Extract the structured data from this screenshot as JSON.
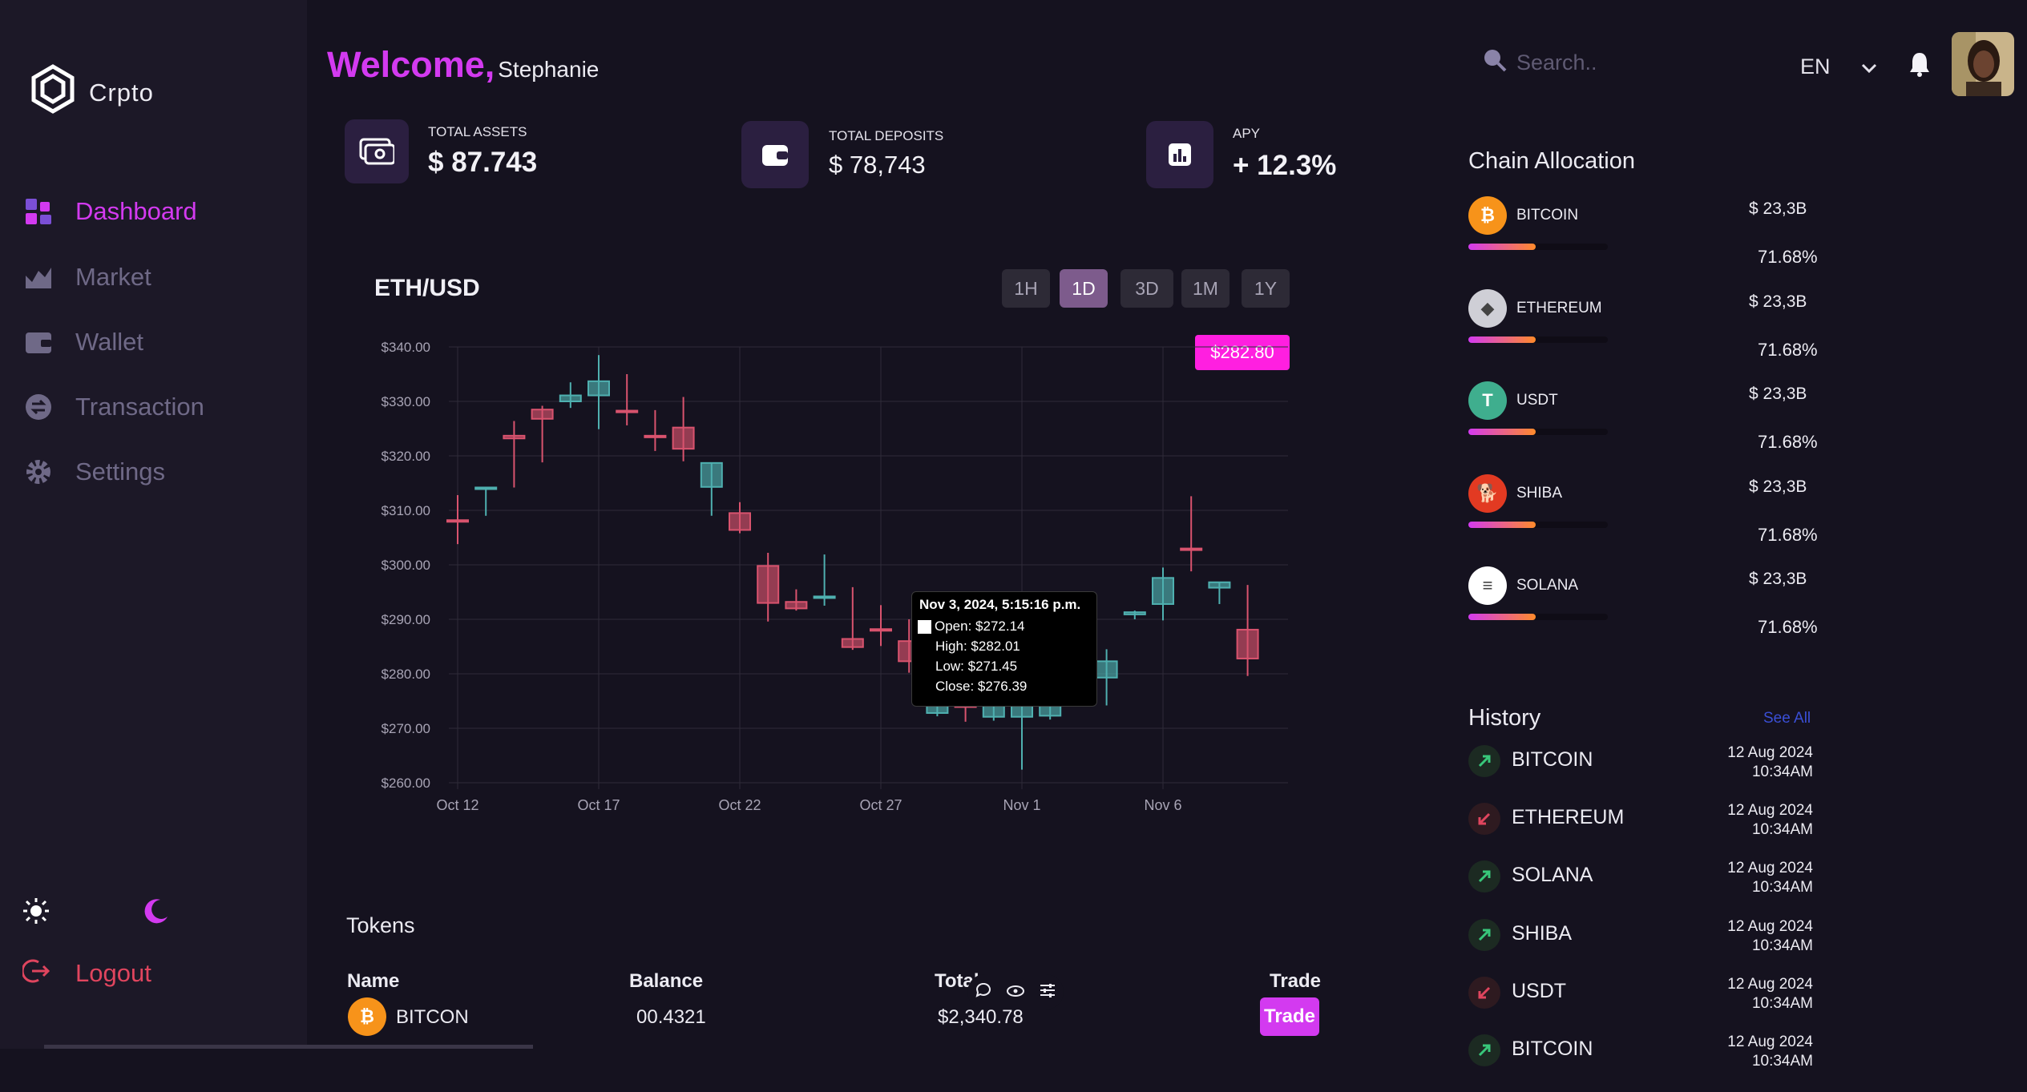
{
  "app": {
    "name": "Crpto"
  },
  "sidebar": {
    "items": [
      {
        "label": "Dashboard",
        "icon": "dashboard-icon",
        "active": true
      },
      {
        "label": "Market",
        "icon": "chart-area-icon",
        "active": false
      },
      {
        "label": "Wallet",
        "icon": "wallet-icon",
        "active": false
      },
      {
        "label": "Transaction",
        "icon": "exchange-icon",
        "active": false
      },
      {
        "label": "Settings",
        "icon": "gear-icon",
        "active": false
      }
    ],
    "logout_label": "Logout"
  },
  "header": {
    "welcome": "Welcome,",
    "user_name": "Stephanie",
    "search_placeholder": "Search..",
    "language": "EN"
  },
  "stats": [
    {
      "label": "TOTAL ASSETS",
      "value": "$ 87.743",
      "icon": "cash-icon"
    },
    {
      "label": "TOTAL DEPOSITS",
      "value": "$ 78,743",
      "icon": "wallet-icon"
    },
    {
      "label": "APY",
      "value": "+ 12.3%",
      "icon": "bar-chart-icon"
    }
  ],
  "chart_card": {
    "pair": "ETH/USD",
    "timeframes": [
      "1H",
      "1D",
      "3D",
      "1M",
      "1Y"
    ],
    "active_timeframe": "1D",
    "current_price": "$282.80"
  },
  "chart_data": {
    "type": "candlestick",
    "title": "ETH/USD",
    "ylim": [
      260,
      340
    ],
    "y_ticks": [
      "$340.00",
      "$330.00",
      "$320.00",
      "$310.00",
      "$300.00",
      "$290.00",
      "$280.00",
      "$270.00",
      "$260.00"
    ],
    "x_tick_labels": [
      "Oct 12",
      "Oct 17",
      "Oct 22",
      "Oct 27",
      "Nov 1",
      "Nov 6"
    ],
    "x_tick_days": [
      0,
      5,
      10,
      15,
      20,
      25
    ],
    "up_color": "#4fb0b0",
    "down_color": "#d9536e",
    "candles": [
      {
        "day": 0,
        "o": 308.2,
        "h": 312.8,
        "l": 303.8,
        "c": 307.9
      },
      {
        "day": 1,
        "o": 313.9,
        "h": 314.2,
        "l": 309.0,
        "c": 314.2
      },
      {
        "day": 2,
        "o": 323.7,
        "h": 326.4,
        "l": 314.2,
        "c": 323.2
      },
      {
        "day": 3,
        "o": 328.5,
        "h": 329.2,
        "l": 318.8,
        "c": 326.8
      },
      {
        "day": 4,
        "o": 330.0,
        "h": 333.5,
        "l": 328.8,
        "c": 331.1
      },
      {
        "day": 5,
        "o": 331.1,
        "h": 338.5,
        "l": 324.9,
        "c": 333.7
      },
      {
        "day": 6,
        "o": 328.3,
        "h": 335.0,
        "l": 325.6,
        "c": 328.0
      },
      {
        "day": 7,
        "o": 323.7,
        "h": 328.4,
        "l": 320.9,
        "c": 323.5
      },
      {
        "day": 8,
        "o": 325.2,
        "h": 330.8,
        "l": 319.0,
        "c": 321.3
      },
      {
        "day": 9,
        "o": 314.3,
        "h": 318.7,
        "l": 309.0,
        "c": 318.7
      },
      {
        "day": 10,
        "o": 309.5,
        "h": 311.5,
        "l": 305.8,
        "c": 306.4
      },
      {
        "day": 11,
        "o": 299.8,
        "h": 302.2,
        "l": 289.6,
        "c": 293.0
      },
      {
        "day": 12,
        "o": 293.2,
        "h": 295.5,
        "l": 291.6,
        "c": 292.0
      },
      {
        "day": 13,
        "o": 294.0,
        "h": 301.9,
        "l": 292.5,
        "c": 294.2
      },
      {
        "day": 14,
        "o": 286.4,
        "h": 295.9,
        "l": 284.4,
        "c": 284.9
      },
      {
        "day": 15,
        "o": 288.2,
        "h": 292.6,
        "l": 285.1,
        "c": 287.9
      },
      {
        "day": 16,
        "o": 286.0,
        "h": 290.0,
        "l": 280.2,
        "c": 282.3
      },
      {
        "day": 17,
        "o": 272.8,
        "h": 276.0,
        "l": 272.2,
        "c": 274.2
      },
      {
        "day": 18,
        "o": 275.0,
        "h": 276.8,
        "l": 271.2,
        "c": 273.9
      },
      {
        "day": 19,
        "o": 272.1,
        "h": 282.0,
        "l": 271.4,
        "c": 276.4
      },
      {
        "day": 20,
        "o": 272.1,
        "h": 282.0,
        "l": 262.4,
        "c": 278.4
      },
      {
        "day": 21,
        "o": 272.3,
        "h": 282.5,
        "l": 271.6,
        "c": 276.0
      },
      {
        "day": 22,
        "o": 285.0,
        "h": 287.0,
        "l": 283.0,
        "c": 286.0
      },
      {
        "day": 23,
        "o": 279.3,
        "h": 284.5,
        "l": 274.2,
        "c": 282.3
      },
      {
        "day": 24,
        "o": 290.9,
        "h": 291.6,
        "l": 290.0,
        "c": 291.3
      },
      {
        "day": 25,
        "o": 292.8,
        "h": 299.5,
        "l": 289.8,
        "c": 297.6
      },
      {
        "day": 26,
        "o": 303.0,
        "h": 312.6,
        "l": 298.8,
        "c": 302.8
      },
      {
        "day": 27,
        "o": 295.8,
        "h": 296.8,
        "l": 292.8,
        "c": 296.8
      },
      {
        "day": 28,
        "o": 288.1,
        "h": 296.3,
        "l": 279.6,
        "c": 282.8
      }
    ],
    "tooltip": {
      "title": "Nov 3, 2024, 5:15:16 p.m.",
      "open": "Open: $272.14",
      "high": "High: $282.01",
      "low": "Low: $271.45",
      "close": "Close: $276.39"
    }
  },
  "tokens": {
    "title": "Tokens",
    "columns": [
      "Name",
      "Balance",
      "Total",
      "Trade"
    ],
    "rows": [
      {
        "name": "BITCON",
        "balance": "00.4321",
        "total": "$2,340.78",
        "action": "Trade"
      }
    ]
  },
  "chain_allocation": {
    "title": "Chain Allocation",
    "items": [
      {
        "name": "BITCOIN",
        "amount": "$ 23,3B",
        "percent": "71.68%",
        "fill": 0.48,
        "color": "#f7931a",
        "glyph": "₿"
      },
      {
        "name": "ETHEREUM",
        "amount": "$ 23,3B",
        "percent": "71.68%",
        "fill": 0.48,
        "color": "#cfcfd6",
        "glyph": "◆"
      },
      {
        "name": "USDT",
        "amount": "$ 23,3B",
        "percent": "71.68%",
        "fill": 0.48,
        "color": "#3fae8e",
        "glyph": "T"
      },
      {
        "name": "SHIBA",
        "amount": "$ 23,3B",
        "percent": "71.68%",
        "fill": 0.48,
        "color": "#e23a22",
        "glyph": "🐕"
      },
      {
        "name": "SOLANA",
        "amount": "$ 23,3B",
        "percent": "71.68%",
        "fill": 0.48,
        "color": "#ffffff",
        "glyph": "≡"
      }
    ]
  },
  "history": {
    "title": "History",
    "see_all": "See All",
    "items": [
      {
        "name": "BITCOIN",
        "date": "12 Aug 2024",
        "time": "10:34AM",
        "direction": "up"
      },
      {
        "name": "ETHEREUM",
        "date": "12 Aug 2024",
        "time": "10:34AM",
        "direction": "down"
      },
      {
        "name": "SOLANA",
        "date": "12 Aug 2024",
        "time": "10:34AM",
        "direction": "up"
      },
      {
        "name": "SHIBA",
        "date": "12 Aug 2024",
        "time": "10:34AM",
        "direction": "up"
      },
      {
        "name": "USDT",
        "date": "12 Aug 2024",
        "time": "10:34AM",
        "direction": "down"
      },
      {
        "name": "BITCOIN",
        "date": "12 Aug 2024",
        "time": "10:34AM",
        "direction": "up"
      }
    ]
  }
}
